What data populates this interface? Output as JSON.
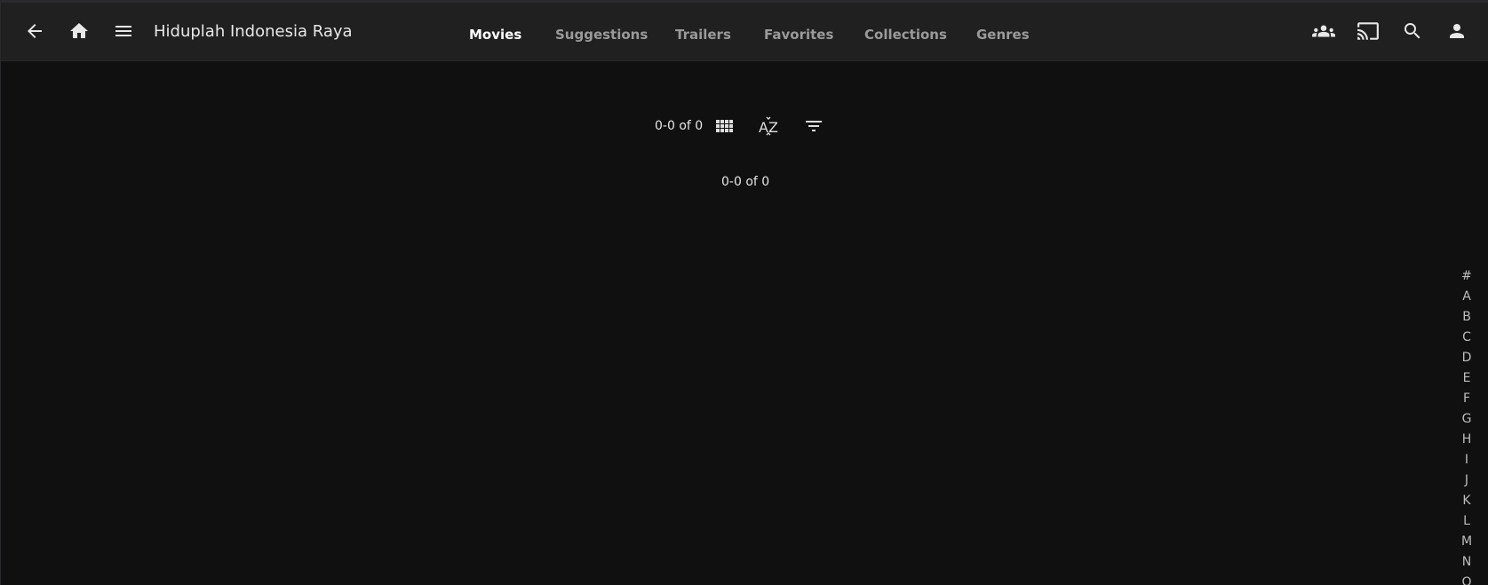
{
  "header": {
    "title": "Hiduplah Indonesia Raya",
    "icons": {
      "back": "arrow-left-icon",
      "home": "home-icon",
      "menu": "hamburger-menu-icon",
      "sync": "group-icon",
      "cast": "cast-icon",
      "search": "search-icon",
      "user": "user-icon"
    },
    "tabs": [
      {
        "label": "Movies",
        "active": true
      },
      {
        "label": "Suggestions",
        "active": false
      },
      {
        "label": "Trailers",
        "active": false
      },
      {
        "label": "Favorites",
        "active": false
      },
      {
        "label": "Collections",
        "active": false
      },
      {
        "label": "Genres",
        "active": false
      }
    ]
  },
  "toolbar": {
    "count": "0-0 of 0",
    "icons": {
      "view": "grid-view-icon",
      "sort": "sort-az-icon",
      "filter": "filter-icon"
    }
  },
  "paging": {
    "count": "0-0 of 0"
  },
  "alphabet": [
    "#",
    "A",
    "B",
    "C",
    "D",
    "E",
    "F",
    "G",
    "H",
    "I",
    "J",
    "K",
    "L",
    "M",
    "N",
    "O"
  ],
  "colors": {
    "background": "#101010",
    "header": "#202020",
    "active_tab": "#ffffff",
    "inactive_tab": "#9a9a9a"
  }
}
